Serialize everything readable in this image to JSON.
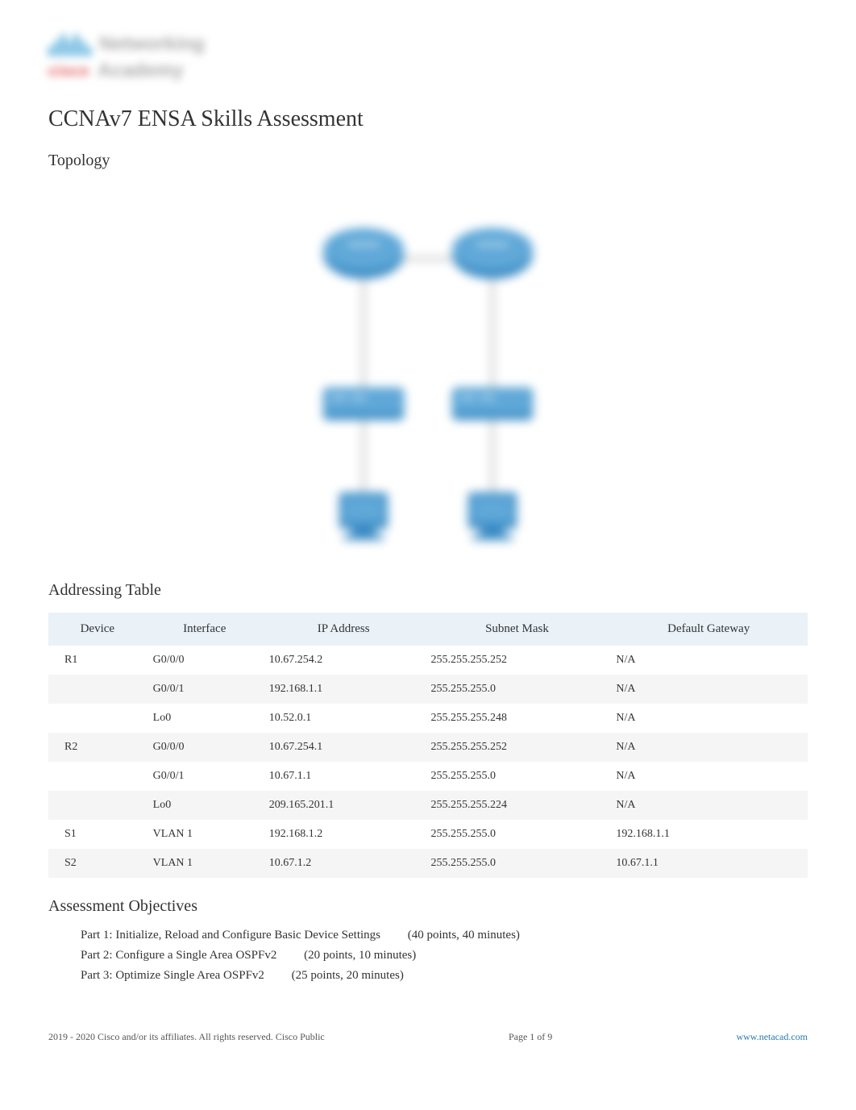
{
  "logo": {
    "text1": "Networking",
    "brand": "cisco",
    "text2": "Academy"
  },
  "title": "CCNAv7 ENSA Skills Assessment",
  "sections": {
    "topology": "Topology",
    "addressing": "Addressing Table",
    "objectives": "Assessment Objectives"
  },
  "addressing_table": {
    "headers": [
      "Device",
      "Interface",
      "IP Address",
      "Subnet Mask",
      "Default Gateway"
    ],
    "rows": [
      {
        "device": "R1",
        "interface": "G0/0/0",
        "ip": "10.67.254.2",
        "mask": "255.255.255.252",
        "gateway": "N/A"
      },
      {
        "device": "",
        "interface": "G0/0/1",
        "ip": "192.168.1.1",
        "mask": "255.255.255.0",
        "gateway": "N/A"
      },
      {
        "device": "",
        "interface": "Lo0",
        "ip": "10.52.0.1",
        "mask": "255.255.255.248",
        "gateway": "N/A"
      },
      {
        "device": "R2",
        "interface": "G0/0/0",
        "ip": "10.67.254.1",
        "mask": "255.255.255.252",
        "gateway": "N/A"
      },
      {
        "device": "",
        "interface": "G0/0/1",
        "ip": "10.67.1.1",
        "mask": "255.255.255.0",
        "gateway": "N/A"
      },
      {
        "device": "",
        "interface": "Lo0",
        "ip": "209.165.201.1",
        "mask": "255.255.255.224",
        "gateway": "N/A"
      },
      {
        "device": "S1",
        "interface": "VLAN 1",
        "ip": "192.168.1.2",
        "mask": "255.255.255.0",
        "gateway": "192.168.1.1"
      },
      {
        "device": "S2",
        "interface": "VLAN 1",
        "ip": "10.67.1.2",
        "mask": "255.255.255.0",
        "gateway": "10.67.1.1"
      }
    ]
  },
  "objectives": [
    {
      "text": "Part 1: Initialize, Reload and Configure Basic Device Settings",
      "points": "(40 points, 40 minutes)"
    },
    {
      "text": "Part 2: Configure a Single Area OSPFv2",
      "points": "(20 points, 10 minutes)"
    },
    {
      "text": "Part 3: Optimize Single Area OSPFv2",
      "points": "(25 points, 20 minutes)"
    }
  ],
  "footer": {
    "copyright": " 2019 - 2020 Cisco and/or its affiliates. All rights reserved. Cisco Public",
    "page": "Page 1 of 9",
    "link": "www.netacad.com"
  }
}
